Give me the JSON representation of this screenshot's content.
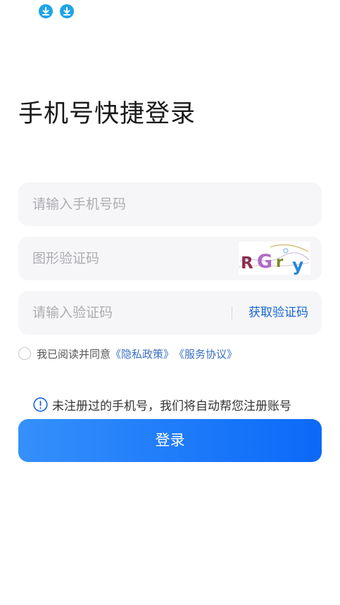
{
  "status_bar": {
    "icons": [
      "download-icon",
      "download-icon"
    ],
    "icon_color": "#1ea4e8"
  },
  "title": "手机号快捷登录",
  "phone_field": {
    "placeholder": "请输入手机号码",
    "value": ""
  },
  "captcha_field": {
    "placeholder": "图形验证码",
    "value": "",
    "captcha_text": "RGry"
  },
  "code_field": {
    "placeholder": "请输入验证码",
    "value": "",
    "get_code_label": "获取验证码"
  },
  "agreement": {
    "prefix": "我已阅读并同意",
    "privacy_link": "《隐私政策》",
    "service_link": "《服务协议》",
    "checked": false
  },
  "notice": {
    "icon": "info-icon",
    "text": "未注册过的手机号，我们将自动帮您注册账号"
  },
  "login_button": {
    "label": "登录"
  },
  "colors": {
    "accent": "#1766d6",
    "button_start": "#3590fb",
    "button_end": "#0b69f8",
    "field_bg": "#f6f6f8",
    "link": "#3b6fc4"
  }
}
